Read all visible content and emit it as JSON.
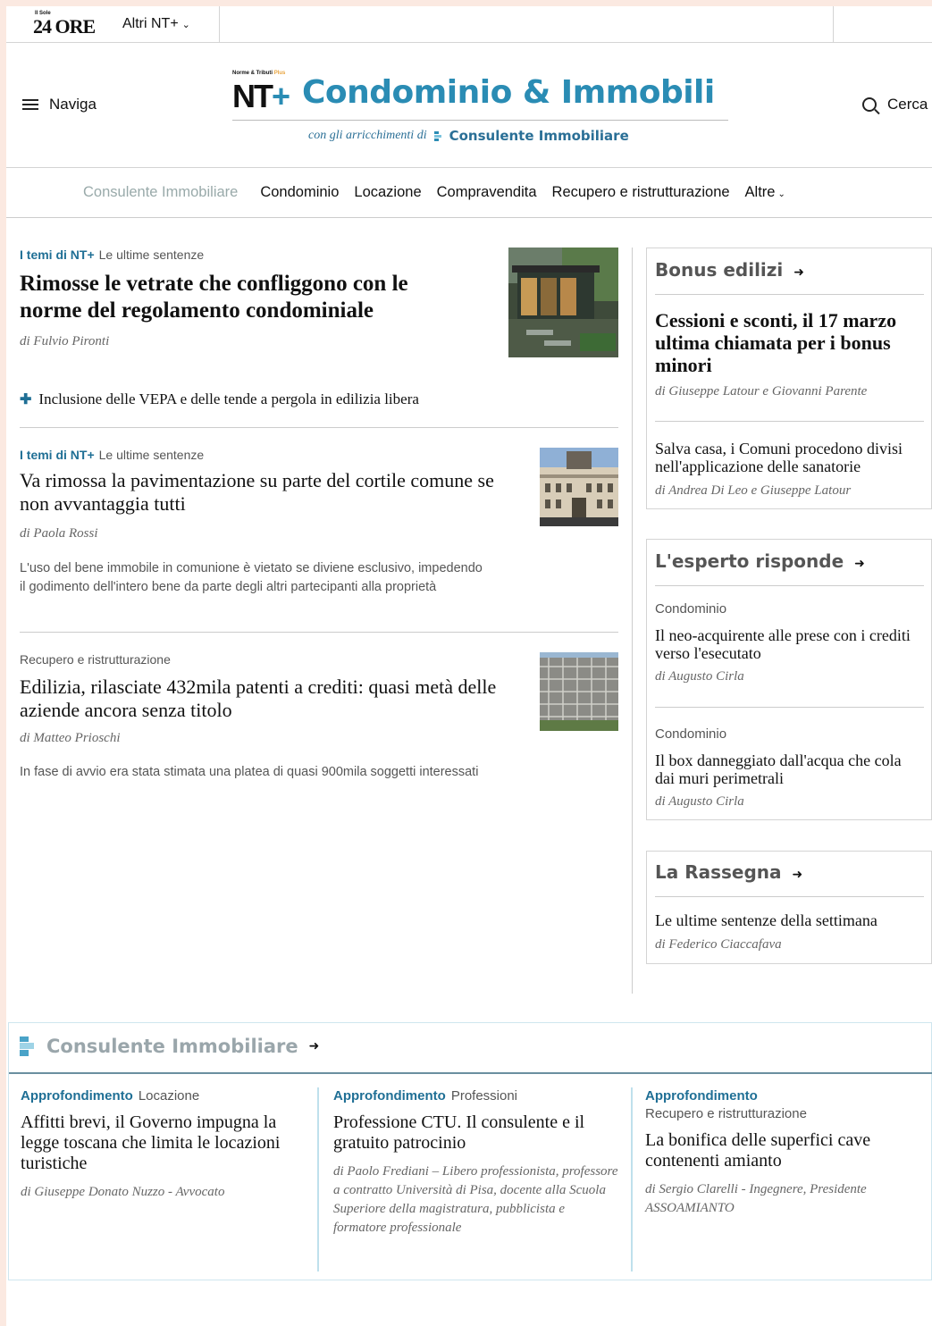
{
  "topbar": {
    "logo_text": "24 ORE",
    "logo_prefix": "Il Sole",
    "altri_label": "Altri NT+"
  },
  "masthead": {
    "menu_label": "Naviga",
    "search_label": "Cerca",
    "brand_mini": "Norme & Tributi",
    "brand_mini_plus": "Plus",
    "brand_prefix": "NT",
    "brand_plus": "+",
    "brand_name": "Condominio & Immobili",
    "sub_text": "con gli arricchimenti di",
    "sub_brand": "Consulente Immobiliare"
  },
  "nav": {
    "items": [
      "Consulente Immobiliare",
      "Condominio",
      "Locazione",
      "Compravendita",
      "Recupero e ristrutturazione",
      "Altre"
    ]
  },
  "main": {
    "articles": [
      {
        "kicker_tag": "I temi di NT+",
        "kicker": "Le ultime sentenze",
        "title": "Rimosse le vetrate che confliggono con le norme del regolamento condominiale",
        "byline": "di Fulvio Pironti",
        "related": "Inclusione delle VEPA e delle tende a pergola in edilizia libera",
        "image": "glass-pergola-house"
      },
      {
        "kicker_tag": "I temi di NT+",
        "kicker": "Le ultime sentenze",
        "title": "Va rimossa la pavimentazione su parte del cortile comune se non avvantaggia tutti",
        "byline": "di Paola Rossi",
        "summary": "L'uso del bene immobile in comunione è vietato se diviene esclusivo, impedendo il godimento dell'intero bene da parte degli altri partecipanti alla proprietà",
        "image": "courthouse-facade"
      },
      {
        "kicker": "Recupero e ristrutturazione",
        "title": "Edilizia, rilasciate 432mila patenti a crediti: quasi metà delle aziende ancora senza titolo",
        "byline": "di Matteo Prioschi",
        "summary": "In fase di avvio era stata stimata una platea di quasi 900mila soggetti interessati",
        "image": "scaffolding-building"
      }
    ]
  },
  "sidebar": {
    "bonus": {
      "heading": "Bonus edilizi",
      "items": [
        {
          "title": "Cessioni e sconti, il 17 marzo ultima chiamata per i bonus minori",
          "byline": "di Giuseppe Latour e Giovanni Parente"
        },
        {
          "title": "Salva casa, i Comuni procedono divisi nell'applicazione delle sanatorie",
          "byline": "di Andrea Di Leo e Giuseppe Latour"
        }
      ]
    },
    "esperto": {
      "heading": "L'esperto risponde",
      "items": [
        {
          "category": "Condominio",
          "title": "Il neo-acquirente alle prese con i crediti verso l'esecutato",
          "byline": "di Augusto Cirla"
        },
        {
          "category": "Condominio",
          "title": "Il box danneggiato dall'acqua che cola dai muri perimetrali",
          "byline": "di Augusto Cirla"
        }
      ]
    },
    "rassegna": {
      "heading": "La Rassegna",
      "items": [
        {
          "title": "Le ultime sentenze della settimana",
          "byline": "di Federico Ciaccafava"
        }
      ]
    }
  },
  "consulente": {
    "heading": "Consulente Immobiliare",
    "columns": [
      {
        "tag": "Approfondimento",
        "category": "Locazione",
        "title": "Affitti brevi, il Governo impugna la legge toscana che limita le locazioni turistiche",
        "byline": "di Giuseppe Donato Nuzzo - Avvocato"
      },
      {
        "tag": "Approfondimento",
        "category": "Professioni",
        "title": "Professione CTU. Il consulente e il gratuito patrocinio",
        "byline": "di Paolo Frediani – Libero professionista, professore a contratto Università di Pisa, docente alla Scuola Superiore della magistratura, pubblicista e formatore professionale"
      },
      {
        "tag": "Approfondimento",
        "category": "Recupero e ristrutturazione",
        "title": "La bonifica delle superfici cave contenenti amianto",
        "byline": "di Sergio Clarelli - Ingegnere, Presidente ASSOAMIANTO"
      }
    ]
  },
  "colors": {
    "accent": "#2a8cb4",
    "accent_dark": "#1f6f95",
    "frame": "#fbe9e1"
  }
}
